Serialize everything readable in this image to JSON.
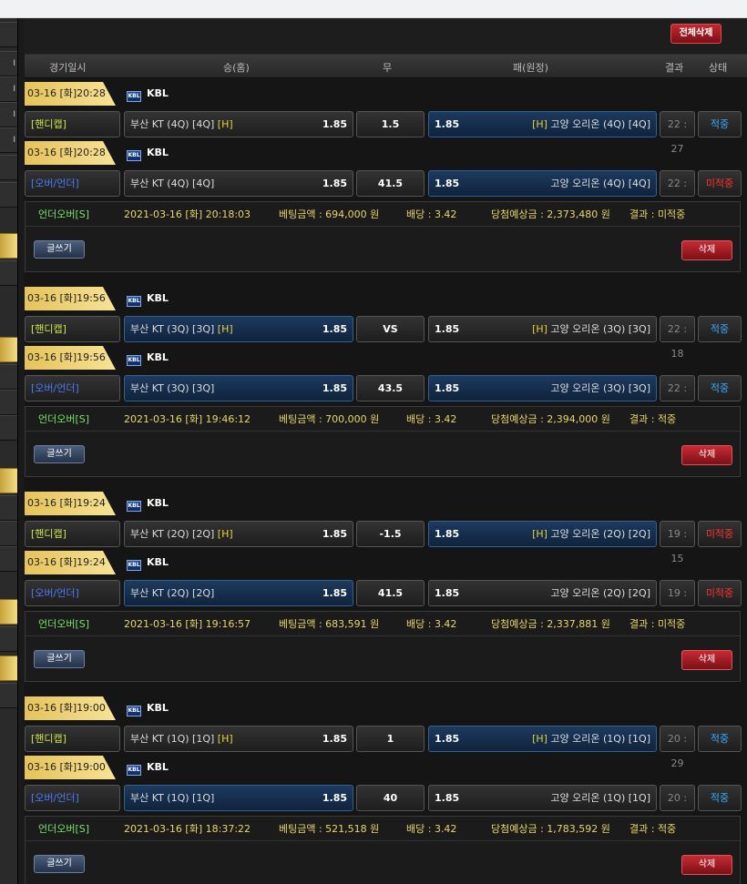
{
  "toolbar": {
    "delete_all": "전체삭제",
    "write": "글쓰기",
    "delete": "삭제"
  },
  "header": {
    "date": "경기일시",
    "home": "승(홈)",
    "draw": "무",
    "away": "패(원정)",
    "result": "결과",
    "status": "상태"
  },
  "sidebar": {
    "marks": [
      "",
      "I",
      "I",
      "I",
      "I"
    ]
  },
  "groups": [
    {
      "rows": [
        {
          "date": "03-16 [화]20:28",
          "league": "KBL",
          "type": "[핸디캡]",
          "home": "부산 KT (4Q) [4Q]",
          "home_h": "[H]",
          "home_odds": "1.85",
          "mid": "1.5",
          "away_odds": "1.85",
          "away_h": "[H]",
          "away": "고양 오리온 (4Q) [4Q]",
          "score": "22 : 27",
          "status": "적중"
        },
        {
          "date": "03-16 [화]20:28",
          "league": "KBL",
          "type": "[오버/언더]",
          "home": "부산 KT (4Q) [4Q]",
          "home_h": "",
          "home_odds": "1.85",
          "mid": "41.5",
          "away_odds": "1.85",
          "away_h": "",
          "away": "고양 오리온 (4Q) [4Q]",
          "score": "22 : 27",
          "status": "미적중"
        }
      ],
      "bet": {
        "type": "언더오버[S]",
        "time": "2021-03-16 [화] 20:18:03",
        "amount": "베팅금액 : 694,000 원",
        "odds": "배당 : 3.42",
        "expected": "당첨예상금 : 2,373,480 원",
        "result": "결과 : 미적중"
      }
    },
    {
      "rows": [
        {
          "date": "03-16 [화]19:56",
          "league": "KBL",
          "type": "[핸디캡]",
          "home": "부산 KT (3Q) [3Q]",
          "home_h": "[H]",
          "home_odds": "1.85",
          "mid": "VS",
          "away_odds": "1.85",
          "away_h": "[H]",
          "away": "고양 오리온 (3Q) [3Q]",
          "score": "22 : 18",
          "status": "적중"
        },
        {
          "date": "03-16 [화]19:56",
          "league": "KBL",
          "type": "[오버/언더]",
          "home": "부산 KT (3Q) [3Q]",
          "home_h": "",
          "home_odds": "1.85",
          "mid": "43.5",
          "away_odds": "1.85",
          "away_h": "",
          "away": "고양 오리온 (3Q) [3Q]",
          "score": "22 : 18",
          "status": "적중"
        }
      ],
      "bet": {
        "type": "언더오버[S]",
        "time": "2021-03-16 [화] 19:46:12",
        "amount": "베팅금액 : 700,000 원",
        "odds": "배당 : 3.42",
        "expected": "당첨예상금 : 2,394,000 원",
        "result": "결과 : 적중"
      }
    },
    {
      "rows": [
        {
          "date": "03-16 [화]19:24",
          "league": "KBL",
          "type": "[핸디캡]",
          "home": "부산 KT (2Q) [2Q]",
          "home_h": "[H]",
          "home_odds": "1.85",
          "mid": "-1.5",
          "away_odds": "1.85",
          "away_h": "[H]",
          "away": "고양 오리온 (2Q) [2Q]",
          "score": "19 : 15",
          "status": "미적중"
        },
        {
          "date": "03-16 [화]19:24",
          "league": "KBL",
          "type": "[오버/언더]",
          "home": "부산 KT (2Q) [2Q]",
          "home_h": "",
          "home_odds": "1.85",
          "mid": "41.5",
          "away_odds": "1.85",
          "away_h": "",
          "away": "고양 오리온 (2Q) [2Q]",
          "score": "19 : 15",
          "status": "미적중"
        }
      ],
      "bet": {
        "type": "언더오버[S]",
        "time": "2021-03-16 [화] 19:16:57",
        "amount": "베팅금액 : 683,591 원",
        "odds": "배당 : 3.42",
        "expected": "당첨예상금 : 2,337,881 원",
        "result": "결과 : 미적중"
      }
    },
    {
      "rows": [
        {
          "date": "03-16 [화]19:00",
          "league": "KBL",
          "type": "[핸디캡]",
          "home": "부산 KT (1Q) [1Q]",
          "home_h": "[H]",
          "home_odds": "1.85",
          "mid": "1",
          "away_odds": "1.85",
          "away_h": "[H]",
          "away": "고양 오리온 (1Q) [1Q]",
          "score": "20 : 29",
          "status": "적중"
        },
        {
          "date": "03-16 [화]19:00",
          "league": "KBL",
          "type": "[오버/언더]",
          "home": "부산 KT (1Q) [1Q]",
          "home_h": "",
          "home_odds": "1.85",
          "mid": "40",
          "away_odds": "1.85",
          "away_h": "",
          "away": "고양 오리온 (1Q) [1Q]",
          "score": "20 : 29",
          "status": "적중"
        }
      ],
      "bet": {
        "type": "언더오버[S]",
        "time": "2021-03-16 [화] 18:37:22",
        "amount": "베팅금액 : 521,518 원",
        "odds": "배당 : 3.42",
        "expected": "당첨예상금 : 1,783,592 원",
        "result": "결과 : 적중"
      }
    }
  ],
  "colors": {
    "selected": "#1d3a5e",
    "win": "#3aa8ff",
    "lose": "#ff3030",
    "gold": "#e6c35a"
  }
}
